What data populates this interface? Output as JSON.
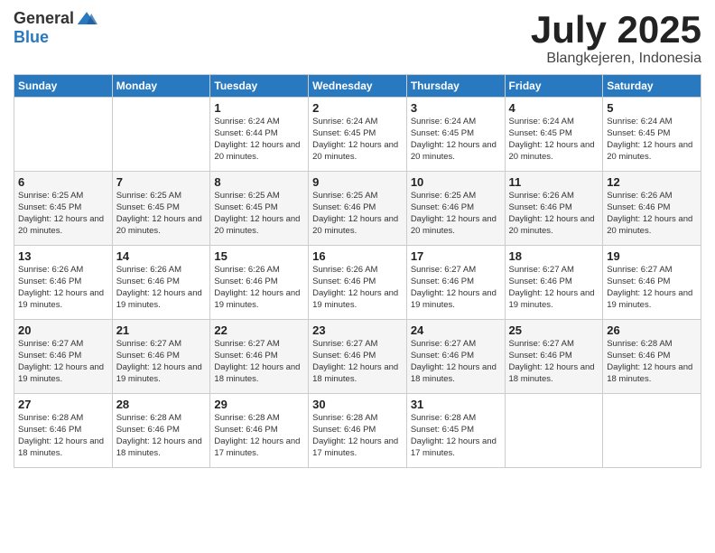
{
  "header": {
    "logo_general": "General",
    "logo_blue": "Blue",
    "month_title": "July 2025",
    "location": "Blangkejeren, Indonesia"
  },
  "weekdays": [
    "Sunday",
    "Monday",
    "Tuesday",
    "Wednesday",
    "Thursday",
    "Friday",
    "Saturday"
  ],
  "weeks": [
    [
      {
        "day": "",
        "info": ""
      },
      {
        "day": "",
        "info": ""
      },
      {
        "day": "1",
        "info": "Sunrise: 6:24 AM\nSunset: 6:44 PM\nDaylight: 12 hours and 20 minutes."
      },
      {
        "day": "2",
        "info": "Sunrise: 6:24 AM\nSunset: 6:45 PM\nDaylight: 12 hours and 20 minutes."
      },
      {
        "day": "3",
        "info": "Sunrise: 6:24 AM\nSunset: 6:45 PM\nDaylight: 12 hours and 20 minutes."
      },
      {
        "day": "4",
        "info": "Sunrise: 6:24 AM\nSunset: 6:45 PM\nDaylight: 12 hours and 20 minutes."
      },
      {
        "day": "5",
        "info": "Sunrise: 6:24 AM\nSunset: 6:45 PM\nDaylight: 12 hours and 20 minutes."
      }
    ],
    [
      {
        "day": "6",
        "info": "Sunrise: 6:25 AM\nSunset: 6:45 PM\nDaylight: 12 hours and 20 minutes."
      },
      {
        "day": "7",
        "info": "Sunrise: 6:25 AM\nSunset: 6:45 PM\nDaylight: 12 hours and 20 minutes."
      },
      {
        "day": "8",
        "info": "Sunrise: 6:25 AM\nSunset: 6:45 PM\nDaylight: 12 hours and 20 minutes."
      },
      {
        "day": "9",
        "info": "Sunrise: 6:25 AM\nSunset: 6:46 PM\nDaylight: 12 hours and 20 minutes."
      },
      {
        "day": "10",
        "info": "Sunrise: 6:25 AM\nSunset: 6:46 PM\nDaylight: 12 hours and 20 minutes."
      },
      {
        "day": "11",
        "info": "Sunrise: 6:26 AM\nSunset: 6:46 PM\nDaylight: 12 hours and 20 minutes."
      },
      {
        "day": "12",
        "info": "Sunrise: 6:26 AM\nSunset: 6:46 PM\nDaylight: 12 hours and 20 minutes."
      }
    ],
    [
      {
        "day": "13",
        "info": "Sunrise: 6:26 AM\nSunset: 6:46 PM\nDaylight: 12 hours and 19 minutes."
      },
      {
        "day": "14",
        "info": "Sunrise: 6:26 AM\nSunset: 6:46 PM\nDaylight: 12 hours and 19 minutes."
      },
      {
        "day": "15",
        "info": "Sunrise: 6:26 AM\nSunset: 6:46 PM\nDaylight: 12 hours and 19 minutes."
      },
      {
        "day": "16",
        "info": "Sunrise: 6:26 AM\nSunset: 6:46 PM\nDaylight: 12 hours and 19 minutes."
      },
      {
        "day": "17",
        "info": "Sunrise: 6:27 AM\nSunset: 6:46 PM\nDaylight: 12 hours and 19 minutes."
      },
      {
        "day": "18",
        "info": "Sunrise: 6:27 AM\nSunset: 6:46 PM\nDaylight: 12 hours and 19 minutes."
      },
      {
        "day": "19",
        "info": "Sunrise: 6:27 AM\nSunset: 6:46 PM\nDaylight: 12 hours and 19 minutes."
      }
    ],
    [
      {
        "day": "20",
        "info": "Sunrise: 6:27 AM\nSunset: 6:46 PM\nDaylight: 12 hours and 19 minutes."
      },
      {
        "day": "21",
        "info": "Sunrise: 6:27 AM\nSunset: 6:46 PM\nDaylight: 12 hours and 19 minutes."
      },
      {
        "day": "22",
        "info": "Sunrise: 6:27 AM\nSunset: 6:46 PM\nDaylight: 12 hours and 18 minutes."
      },
      {
        "day": "23",
        "info": "Sunrise: 6:27 AM\nSunset: 6:46 PM\nDaylight: 12 hours and 18 minutes."
      },
      {
        "day": "24",
        "info": "Sunrise: 6:27 AM\nSunset: 6:46 PM\nDaylight: 12 hours and 18 minutes."
      },
      {
        "day": "25",
        "info": "Sunrise: 6:27 AM\nSunset: 6:46 PM\nDaylight: 12 hours and 18 minutes."
      },
      {
        "day": "26",
        "info": "Sunrise: 6:28 AM\nSunset: 6:46 PM\nDaylight: 12 hours and 18 minutes."
      }
    ],
    [
      {
        "day": "27",
        "info": "Sunrise: 6:28 AM\nSunset: 6:46 PM\nDaylight: 12 hours and 18 minutes."
      },
      {
        "day": "28",
        "info": "Sunrise: 6:28 AM\nSunset: 6:46 PM\nDaylight: 12 hours and 18 minutes."
      },
      {
        "day": "29",
        "info": "Sunrise: 6:28 AM\nSunset: 6:46 PM\nDaylight: 12 hours and 17 minutes."
      },
      {
        "day": "30",
        "info": "Sunrise: 6:28 AM\nSunset: 6:46 PM\nDaylight: 12 hours and 17 minutes."
      },
      {
        "day": "31",
        "info": "Sunrise: 6:28 AM\nSunset: 6:45 PM\nDaylight: 12 hours and 17 minutes."
      },
      {
        "day": "",
        "info": ""
      },
      {
        "day": "",
        "info": ""
      }
    ]
  ]
}
